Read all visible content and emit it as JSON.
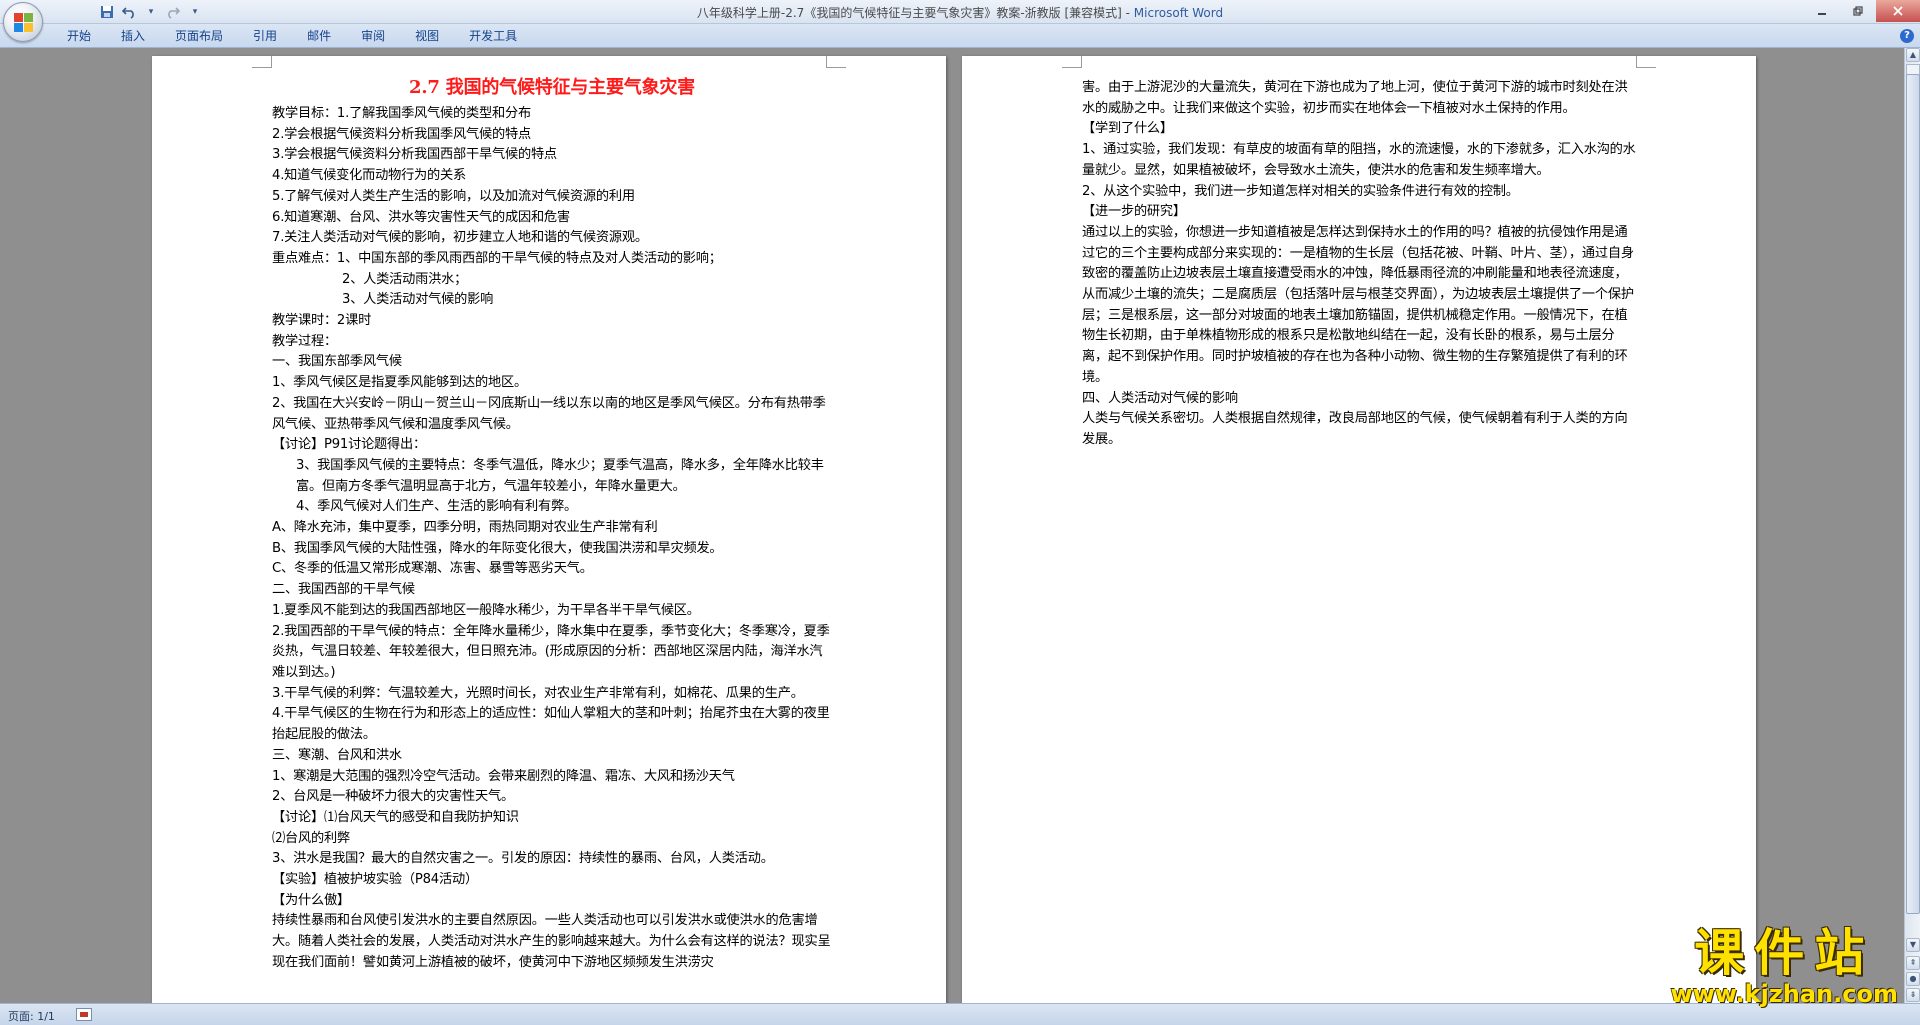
{
  "window": {
    "title": "八年级科学上册-2.7《我国的气候特征与主要气象灾害》教案-浙教版 [兼容模式] - ",
    "app_name": "Microsoft Word",
    "minimize_icon": "minimize-icon",
    "maximize_icon": "restore-icon",
    "close_icon": "close-icon"
  },
  "quick_access": {
    "save_icon": "save-icon",
    "undo_icon": "undo-icon",
    "redo_icon": "redo-icon",
    "customize_icon": "chevron-down-icon"
  },
  "ribbon": {
    "tabs": [
      "开始",
      "插入",
      "页面布局",
      "引用",
      "邮件",
      "审阅",
      "视图",
      "开发工具"
    ],
    "help_label": "?"
  },
  "page1": {
    "title": "2.7 我国的气候特征与主要气象灾害",
    "paragraphs": [
      "教学目标：1.了解我国季风气候的类型和分布",
      "2.学会根据气候资料分析我国季风气候的特点",
      "3.学会根据气候资料分析我国西部干旱气候的特点",
      "4.知道气候变化而动物行为的关系",
      "5.了解气候对人类生产生活的影响，以及加流对气候资源的利用",
      "6.知道寒潮、台风、洪水等灾害性天气的成因和危害",
      "7.关注人类活动对气候的影响，初步建立人地和谐的气候资源观。",
      "重点难点：1、中国东部的季风雨西部的干旱气候的特点及对人类活动的影响；",
      "2、人类活动雨洪水；",
      "3、人类活动对气候的影响",
      "教学课时：2课时",
      "教学过程：",
      "一、我国东部季风气候",
      "1、季风气候区是指夏季风能够到达的地区。",
      "2、我国在大兴安岭－阴山－贺兰山－冈底斯山一线以东以南的地区是季风气候区。分布有热带季风气候、亚热带季风气候和温度季风气候。",
      "【讨论】P91讨论题得出：",
      "3、我国季风气候的主要特点：冬季气温低，降水少；夏季气温高，降水多，全年降水比较丰富。但南方冬季气温明显高于北方，气温年较差小，年降水量更大。",
      "4、季风气候对人们生产、生活的影响有利有弊。",
      "A、降水充沛，集中夏季，四季分明，雨热同期对农业生产非常有利",
      "B、我国季风气候的大陆性强，降水的年际变化很大，使我国洪涝和旱灾频发。",
      "C、冬季的低温又常形成寒潮、冻害、暴雪等恶劣天气。",
      "二、我国西部的干旱气候",
      "1.夏季风不能到达的我国西部地区一般降水稀少，为干旱各半干旱气候区。",
      "2.我国西部的干旱气候的特点：全年降水量稀少，降水集中在夏季，季节变化大；冬季寒冷，夏季炎热，气温日较差、年较差很大，但日照充沛。(形成原因的分析：西部地区深居内陆，海洋水汽难以到达。)",
      "3.干旱气候的利弊：气温较差大，光照时间长，对农业生产非常有利，如棉花、瓜果的生产。",
      "4.干旱气候区的生物在行为和形态上的适应性：如仙人掌粗大的茎和叶刺；抬尾芥虫在大雾的夜里抬起屁股的做法。",
      "三、寒潮、台风和洪水",
      "1、寒潮是大范围的强烈冷空气活动。会带来剧烈的降温、霜冻、大风和扬沙天气",
      "2、台风是一种破坏力很大的灾害性天气。",
      "【讨论】⑴台风天气的感受和自我防护知识",
      "⑵台风的利弊",
      "3、洪水是我国？最大的自然灾害之一。引发的原因：持续性的暴雨、台风，人类活动。",
      "【实验】植被护坡实验（P84活动）",
      "【为什么傲】",
      "持续性暴雨和台风使引发洪水的主要自然原因。一些人类活动也可以引发洪水或使洪水的危害增大。随着人类社会的发展，人类活动对洪水产生的影响越来越大。为什么会有这样的说法？现实呈现在我们面前！譬如黄河上游植被的破坏，使黄河中下游地区频频发生洪涝灾"
    ],
    "indent": [
      0,
      1,
      1,
      1,
      1,
      1,
      1,
      0,
      3,
      3,
      0,
      0,
      0,
      0,
      0,
      0,
      2,
      2,
      0,
      0,
      0,
      0,
      0,
      0,
      0,
      0,
      0,
      0,
      0,
      0,
      0,
      0,
      0,
      0,
      0
    ]
  },
  "page2": {
    "paragraphs": [
      "害。由于上游泥沙的大量流失，黄河在下游也成为了地上河，使位于黄河下游的城市时刻处在洪水的威胁之中。让我们来做这个实验，初步而实在地体会一下植被对水土保持的作用。",
      "【学到了什么】",
      "1、通过实验，我们发现：有草皮的坡面有草的阻挡，水的流速慢，水的下渗就多，汇入水沟的水量就少。显然，如果植被破坏，会导致水土流失，使洪水的危害和发生频率增大。",
      "2、从这个实验中，我们进一步知道怎样对相关的实验条件进行有效的控制。",
      "【进一步的研究】",
      "通过以上的实验，你想进一步知道植被是怎样达到保持水土的作用的吗？植被的抗侵蚀作用是通过它的三个主要构成部分来实现的：一是植物的生长层（包括花被、叶鞘、叶片、茎），通过自身致密的覆盖防止边坡表层土壤直接遭受雨水的冲蚀，降低暴雨径流的冲刷能量和地表径流速度，从而减少土壤的流失；二是腐质层（包括落叶层与根茎交界面），为边坡表层土壤提供了一个保护层；三是根系层，这一部分对坡面的地表土壤加筋锚固，提供机械稳定作用。一般情况下，在植物生长初期，由于单株植物形成的根系只是松散地纠结在一起，没有长卧的根系，易与土层分离，起不到保护作用。同时护坡植被的存在也为各种小动物、微生物的生存繁殖提供了有利的环境。",
      "四、人类活动对气候的影响",
      "人类与气候关系密切。人类根据自然规律，改良局部地区的气候，使气候朝着有利于人类的方向发展。"
    ]
  },
  "status_bar": {
    "page_label": "页面: 1/1"
  },
  "watermark": {
    "title": "课件站",
    "url": "www.kjzhan.com"
  },
  "colors": {
    "title_red": "#ff1a1a",
    "watermark_yellow": "#ffe100",
    "ribbon_blue": "#15428b"
  }
}
